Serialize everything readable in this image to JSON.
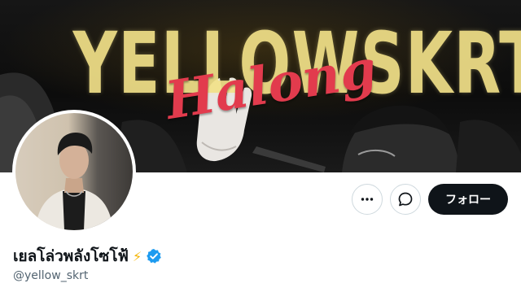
{
  "banner": {
    "title_text": "YELLOWSKRT",
    "script_text": "Halong"
  },
  "profile": {
    "display_name": "เยลโล่วพลังโซโฟ้",
    "name_emoji": "⚡",
    "handle": "@yellow_skrt",
    "verified": true
  },
  "actions": {
    "follow_label": "フォロー",
    "more_icon": "more-horizontal-icon",
    "message_icon": "message-icon"
  },
  "colors": {
    "banner_title": "#f2e189",
    "banner_script": "#e23b4d",
    "follow_button": "#0f1419",
    "verified_badge": "#1d9bf0",
    "handle_text": "#536471"
  }
}
